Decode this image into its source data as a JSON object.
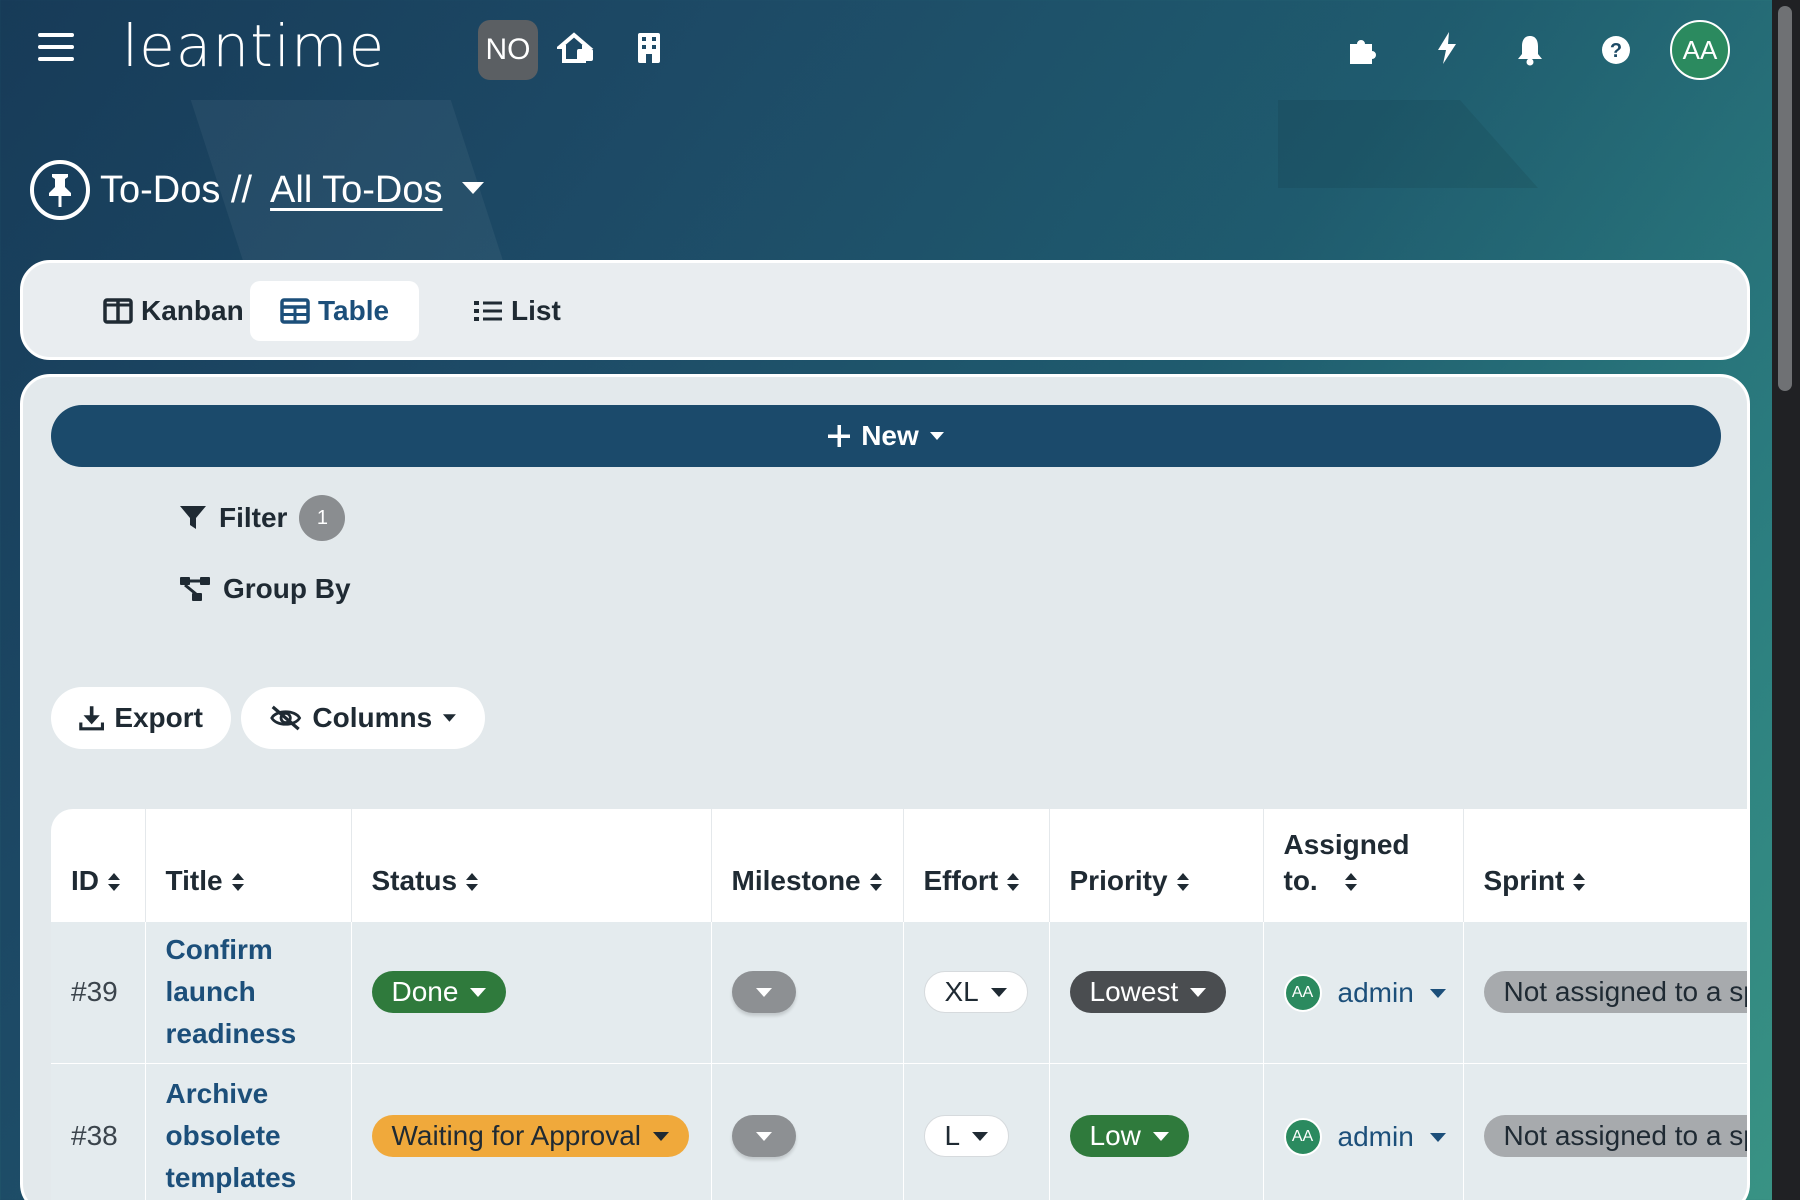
{
  "topbar": {
    "logo": "leantime",
    "project_badge": "NO",
    "user_initials": "AA",
    "icons": [
      "menu-icon",
      "home-switch-icon",
      "building-icon",
      "puzzle-icon",
      "bolt-icon",
      "bell-icon",
      "help-icon"
    ]
  },
  "header": {
    "section": "To-Dos //",
    "view_name": "All To-Dos"
  },
  "tabs": [
    {
      "label": "Kanban",
      "icon": "kanban-icon"
    },
    {
      "label": "Table",
      "icon": "table-icon",
      "active": true
    },
    {
      "label": "List",
      "icon": "list-icon"
    }
  ],
  "toolbar": {
    "new_label": "New",
    "filter_label": "Filter",
    "filter_count": "1",
    "group_label": "Group By",
    "export_label": "Export",
    "columns_label": "Columns"
  },
  "table": {
    "columns": [
      "ID",
      "Title",
      "Status",
      "Milestone",
      "Effort",
      "Priority",
      "Assigned to.",
      "Sprint"
    ],
    "rows": [
      {
        "id": "#39",
        "title": "Confirm launch readiness",
        "status": "Done",
        "effort": "XL",
        "priority": "Lowest",
        "assignee_initials": "AA",
        "assignee": "admin",
        "sprint": "Not assigned to a sp"
      },
      {
        "id": "#38",
        "title": "Archive obsolete templates",
        "status": "Waiting for Approval",
        "effort": "L",
        "priority": "Low",
        "assignee_initials": "AA",
        "assignee": "admin",
        "sprint": "Not assigned to a sp"
      }
    ]
  },
  "colors": {
    "accent": "#1b4a6b",
    "done": "#2f7a3c",
    "waiting": "#f0a93b",
    "lowest": "#4a4d50",
    "avatar": "#2b8a5f"
  }
}
